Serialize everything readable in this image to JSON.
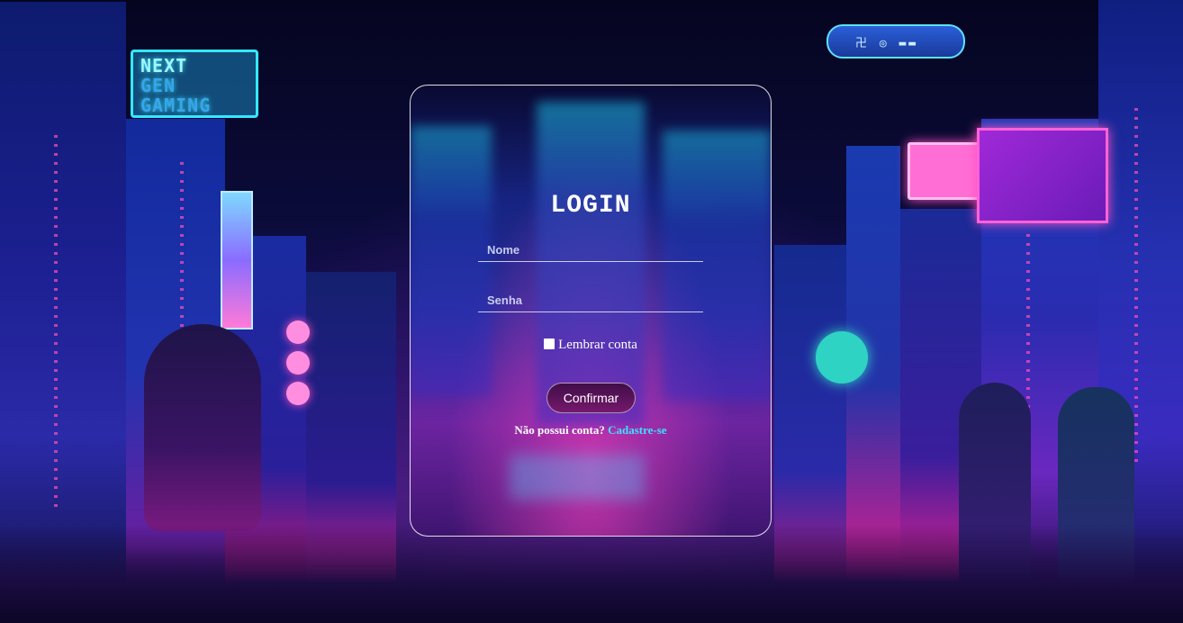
{
  "background": {
    "signs": {
      "next_gen_gaming": [
        "NEXT",
        "GEN",
        "GAMING"
      ],
      "blimp_text": "卍 ◎ ▬▬"
    },
    "accent_colors": {
      "neon_pink": "#ff4fc0",
      "neon_cyan": "#3fe0ff",
      "night_blue": "#0b0b3a"
    }
  },
  "login": {
    "title": "LOGIN",
    "name_field": {
      "placeholder": "Nome",
      "value": ""
    },
    "password_field": {
      "placeholder": "Senha",
      "value": ""
    },
    "remember_label": "Lembrar conta",
    "remember_checked": false,
    "confirm_label": "Confirmar",
    "no_account_text": "Não possui conta?",
    "signup_link": "Cadastre-se"
  }
}
